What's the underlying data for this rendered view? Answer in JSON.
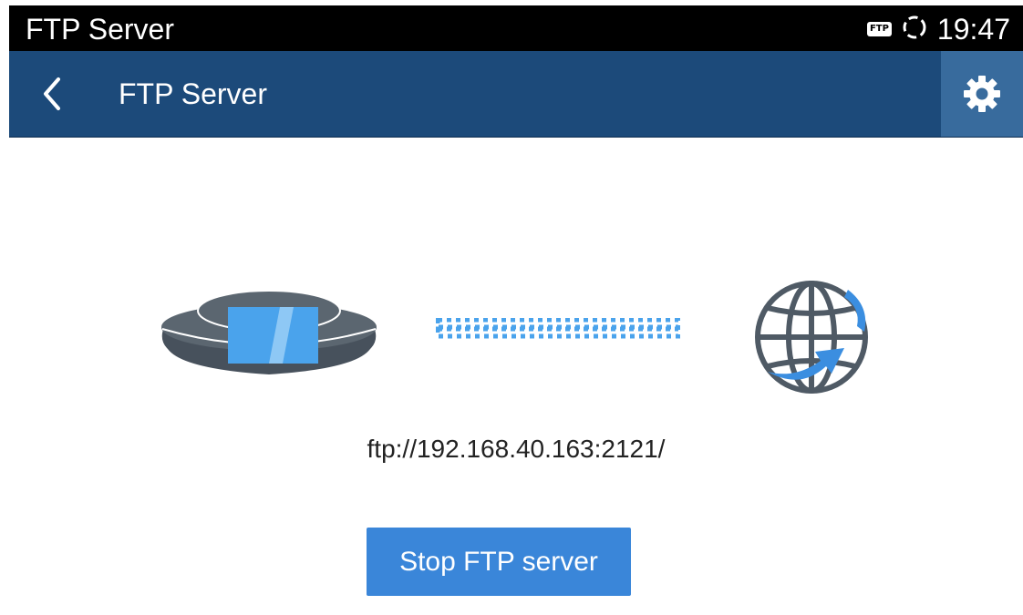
{
  "status_bar": {
    "title": "FTP Server",
    "ftp_badge": "FTP",
    "sync_icon": "sync-icon",
    "time": "19:47"
  },
  "toolbar": {
    "back_icon": "chevron-left-icon",
    "title": "FTP Server",
    "settings_icon": "gear-icon"
  },
  "main": {
    "server_url": "ftp://192.168.40.163:2121/",
    "stop_button_label": "Stop FTP server"
  },
  "colors": {
    "toolbar_bg": "#1c4a7a",
    "settings_bg": "#386b9d",
    "accent": "#3a86d9",
    "device_body": "#4f5a65"
  }
}
